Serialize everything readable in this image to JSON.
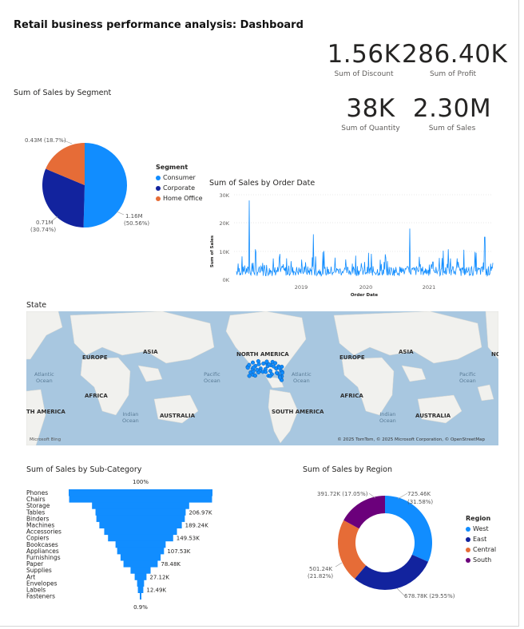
{
  "page": {
    "title": "Retail business performance analysis: Dashboard"
  },
  "kpis": [
    {
      "value": "1.56K",
      "label": "Sum of Discount"
    },
    {
      "value": "286.40K",
      "label": "Sum of Profit"
    },
    {
      "value": "38K",
      "label": "Sum of Quantity"
    },
    {
      "value": "2.30M",
      "label": "Sum of Sales"
    }
  ],
  "segment_chart": {
    "title": "Sum of Sales by Segment",
    "legend_title": "Segment",
    "labels": [
      "1.16M",
      "(50.56%)",
      "0.71M",
      "(30.74%)",
      "0.43M (18.7%)"
    ]
  },
  "date_chart": {
    "title": "Sum of Sales by Order Date",
    "ylabel": "Sum of Sales",
    "xlabel": "Order Date",
    "y_ticks": [
      "0K",
      "10K",
      "20K",
      "30K"
    ],
    "x_ticks": [
      "2019",
      "2020",
      "2021"
    ]
  },
  "map": {
    "title": "State",
    "continents": [
      "EUROPE",
      "ASIA",
      "NORTH AMERICA",
      "EUROPE",
      "ASIA",
      "AFRICA",
      "AFRICA",
      "TH AMERICA",
      "SOUTH AMERICA",
      "AUSTRALIA",
      "AUSTRALIA",
      "NO"
    ],
    "oceans": [
      "Atlantic",
      "Ocean",
      "Pacific",
      "Ocean",
      "Atlantic",
      "Ocean",
      "Pacific",
      "Ocean",
      "Indian",
      "Ocean",
      "Indian",
      "Ocean"
    ],
    "credit": "© 2025 TomTom, © 2025 Microsoft Corporation, © OpenStreetMap",
    "provider": "Microsoft Bing"
  },
  "subcat_chart": {
    "title": "Sum of Sales by Sub-Category",
    "top_label": "100%",
    "bottom_label": "0.9%"
  },
  "region_chart": {
    "title": "Sum of Sales by Region",
    "legend_title": "Region",
    "labels": [
      "725.46K",
      "(31.58%)",
      "678.78K (29.55%)",
      "501.24K",
      "(21.82%)",
      "391.72K (17.05%)"
    ]
  },
  "chart_data": [
    {
      "type": "pie",
      "categories": [
        "Consumer",
        "Corporate",
        "Home Office"
      ],
      "values": [
        1.16,
        0.71,
        0.43
      ],
      "percents": [
        50.56,
        30.74,
        18.7
      ],
      "unit": "M",
      "colors": [
        "#118dff",
        "#12239e",
        "#e66c37"
      ]
    },
    {
      "type": "line",
      "x_range": [
        "2018-01",
        "2021-12"
      ],
      "ylim": [
        0,
        30000
      ],
      "peaks": [
        {
          "x": "2018-03",
          "y": 28000
        },
        {
          "x": "2019-03",
          "y": 16000
        },
        {
          "x": "2020-09",
          "y": 18000
        },
        {
          "x": "2021-11",
          "y": 15000
        }
      ],
      "color": "#118dff"
    },
    {
      "type": "bar",
      "orientation": "funnel",
      "categories": [
        "Phones",
        "Chairs",
        "Storage",
        "Tables",
        "Binders",
        "Machines",
        "Accessories",
        "Copiers",
        "Bookcases",
        "Appliances",
        "Furnishings",
        "Paper",
        "Supplies",
        "Art",
        "Envelopes",
        "Labels",
        "Fasteners"
      ],
      "values": [
        330000,
        328000,
        223000,
        206970,
        203000,
        189240,
        167000,
        149530,
        115000,
        107530,
        92000,
        78480,
        46000,
        27120,
        16000,
        12490,
        3000
      ],
      "value_labels": [
        "",
        "",
        "",
        "206.97K",
        "",
        "189.24K",
        "",
        "149.53K",
        "",
        "107.53K",
        "",
        "78.48K",
        "",
        "27.12K",
        "",
        "12.49K",
        ""
      ],
      "color": "#118dff"
    },
    {
      "type": "pie",
      "variant": "donut",
      "categories": [
        "West",
        "East",
        "Central",
        "South"
      ],
      "values": [
        725.46,
        678.78,
        501.24,
        391.72
      ],
      "percents": [
        31.58,
        29.55,
        21.82,
        17.05
      ],
      "unit": "K",
      "colors": [
        "#118dff",
        "#12239e",
        "#e66c37",
        "#6b007b"
      ]
    }
  ]
}
